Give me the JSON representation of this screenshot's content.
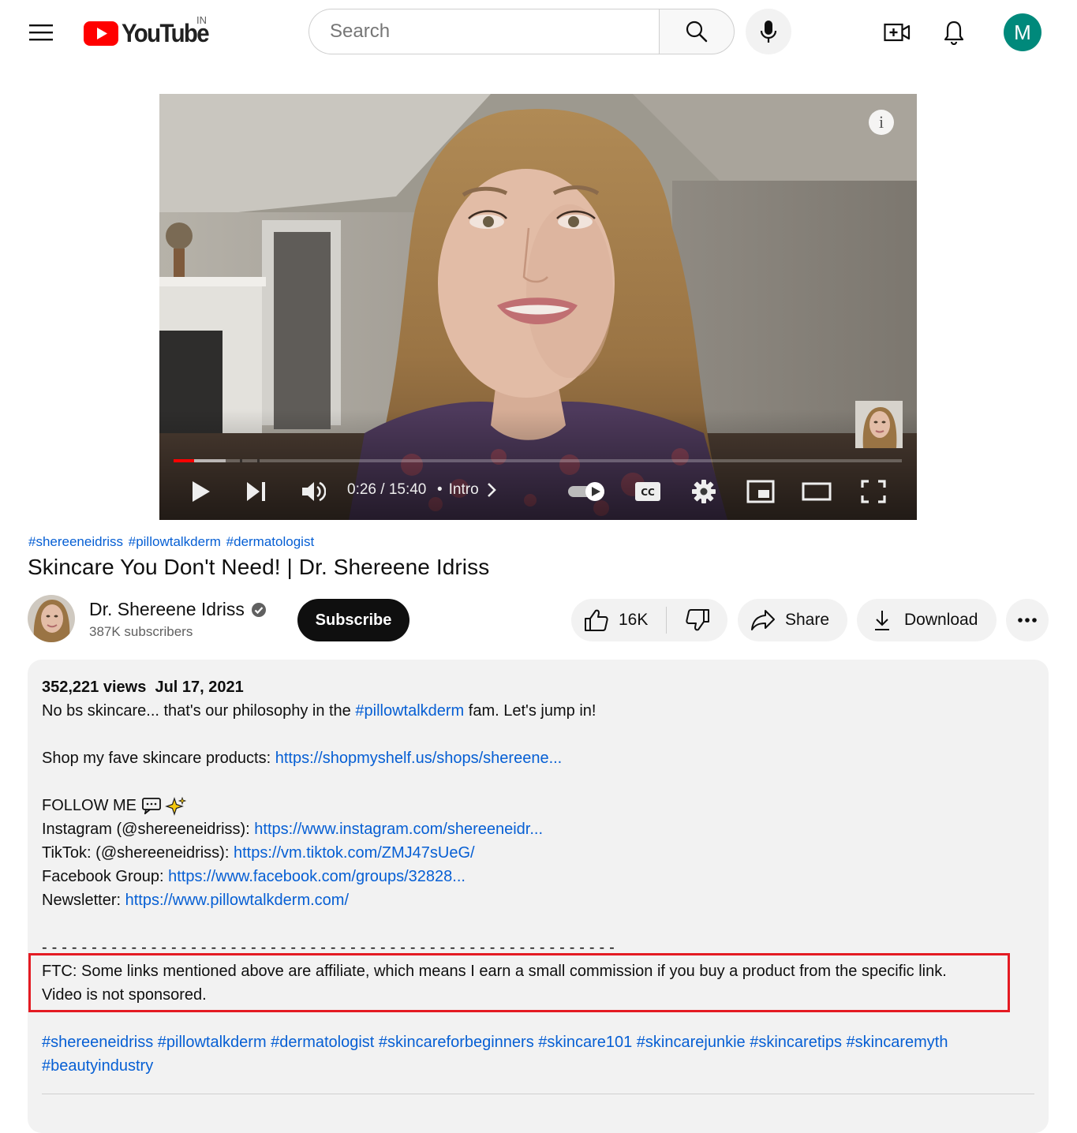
{
  "masthead": {
    "logo_text": "YouTube",
    "country_code": "IN",
    "search_placeholder": "Search",
    "avatar_letter": "M",
    "avatar_color": "#00897b",
    "brand_red": "#ff0000"
  },
  "player": {
    "current_time": "0:26",
    "duration": "15:40",
    "time_display": "0:26 / 15:40",
    "chapter": "Intro",
    "progress_fraction": 0.028,
    "buffer_fraction": 0.072,
    "info_glyph": "i",
    "autoplay": true
  },
  "video": {
    "top_hashtags": [
      "#shereeneidriss",
      "#pillowtalkderm",
      "#dermatologist"
    ],
    "title": "Skincare You Don't Need! | Dr. Shereene Idriss"
  },
  "channel": {
    "name": "Dr. Shereene Idriss",
    "verified": true,
    "subscribers": "387K subscribers"
  },
  "actions": {
    "subscribe_label": "Subscribe",
    "like_count": "16K",
    "share_label": "Share",
    "download_label": "Download"
  },
  "description": {
    "views": "352,221 views",
    "date": "Jul 17, 2021",
    "intro_prefix": "No bs skincare... that's our philosophy in the ",
    "intro_tag": "#pillowtalkderm",
    "intro_suffix": " fam. Let's jump in!",
    "shop_label": "Shop my fave skincare products: ",
    "shop_link": "https://shopmyshelf.us/shops/shereene...",
    "follow_heading": "FOLLOW ME",
    "socials": [
      {
        "label": "Instagram (@shereeneidriss): ",
        "link": "https://www.instagram.com/shereeneidr..."
      },
      {
        "label": "TikTok: (@shereeneidriss): ",
        "link": "https://vm.tiktok.com/ZMJ47sUeG/"
      },
      {
        "label": "Facebook Group: ",
        "link": "https://www.facebook.com/groups/32828..."
      },
      {
        "label": "Newsletter: ",
        "link": "https://www.pillowtalkderm.com/"
      }
    ],
    "divider": "- - - - - - - - - - - - - - - - - - - - - - - - - - - - - - - - - - - - - - - - - - - - - - - - - - - - - - - - - -",
    "ftc_line1": "FTC: Some links mentioned above are affiliate, which means I earn a small commission if you buy a product from the specific link.",
    "ftc_line2": "Video is not sponsored.",
    "hashtags_line1": [
      "#shereeneidriss",
      "#pillowtalkderm",
      "#dermatologist",
      "#skincareforbeginners",
      "#skincare101",
      "#skincarejunkie",
      "#skincaretips",
      "#skincaremyth"
    ],
    "hashtags_line2": [
      "#beautyindustry"
    ],
    "highlight_color": "#e41b23"
  }
}
